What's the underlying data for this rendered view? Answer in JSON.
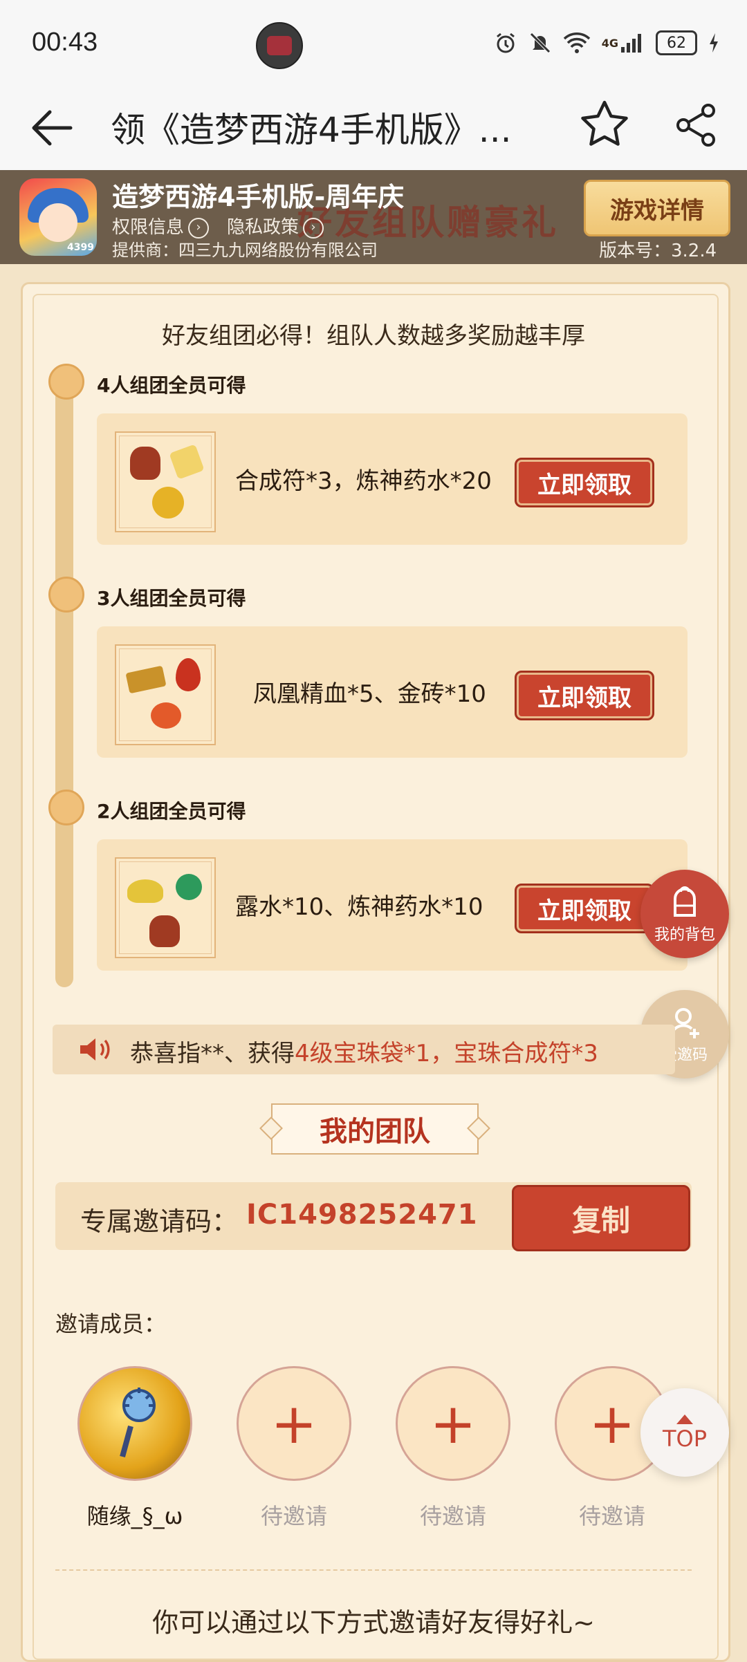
{
  "status_bar": {
    "time": "00:43",
    "battery": "62",
    "network": "4G"
  },
  "nav": {
    "title": "领《造梦西游4手机版》..."
  },
  "banner": {
    "app_name": "造梦西游4手机版-周年庆",
    "bg_text": "好友组队赠豪礼",
    "permissions": "权限信息",
    "privacy": "隐私政策",
    "provider": "提供商：四三九九网络股份有限公司",
    "detail_button": "游戏详情",
    "version": "版本号：3.2.4",
    "app_icon_badge": "4399"
  },
  "subtitle": "好友组团必得！组队人数越多奖励越丰厚",
  "tiers": [
    {
      "label": "4人组团全员可得",
      "reward": "合成符*3，炼神药水*20",
      "button": "立即领取"
    },
    {
      "label": "3人组团全员可得",
      "reward": "凤凰精血*5、金砖*10",
      "button": "立即领取"
    },
    {
      "label": "2人组团全员可得",
      "reward": "露水*10、炼神药水*10",
      "button": "立即领取"
    }
  ],
  "floating": {
    "bag": "我的背包",
    "invited_code": "受邀码",
    "top": "TOP"
  },
  "ticker": {
    "prefix": "恭喜指**、获得",
    "highlight": "4级宝珠袋*1，宝珠合成符*3"
  },
  "team": {
    "title": "我的团队",
    "invite_label": "专属邀请码：",
    "invite_code": "IC1498252471",
    "copy_button": "复制",
    "members_label": "邀请成员：",
    "members": [
      {
        "name": "随缘_§_ω",
        "joined": true
      },
      {
        "name": "待邀请",
        "joined": false
      },
      {
        "name": "待邀请",
        "joined": false
      },
      {
        "name": "待邀请",
        "joined": false
      }
    ]
  },
  "invite_hint": "你可以通过以下方式邀请好友得好礼~",
  "colors": {
    "accent_red": "#c9442e",
    "card_bg": "#fbf0dc",
    "gold": "#efc574"
  }
}
